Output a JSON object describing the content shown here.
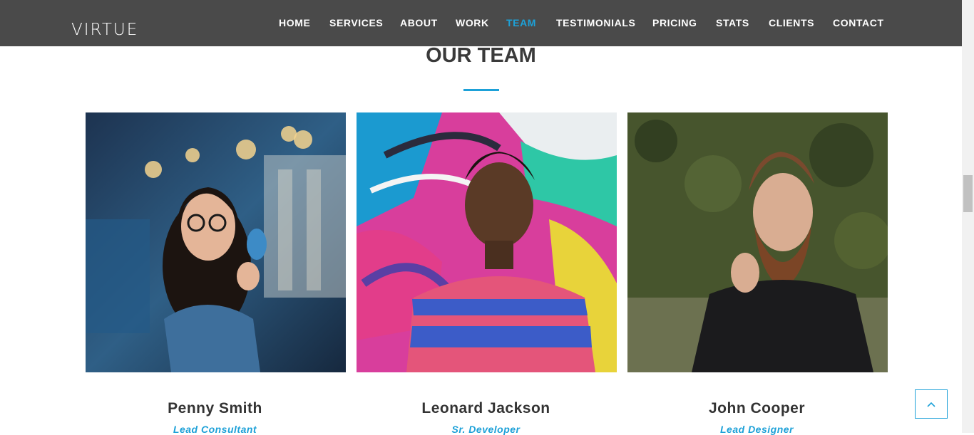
{
  "header": {
    "logo": "VIRTUE",
    "nav": [
      {
        "label": "HOME",
        "active": false
      },
      {
        "label": "SERVICES",
        "active": false
      },
      {
        "label": "ABOUT",
        "active": false
      },
      {
        "label": "WORK",
        "active": false
      },
      {
        "label": "TEAM",
        "active": true
      },
      {
        "label": "TESTIMONIALS",
        "active": false
      },
      {
        "label": "PRICING",
        "active": false
      },
      {
        "label": "STATS",
        "active": false
      },
      {
        "label": "CLIENTS",
        "active": false
      },
      {
        "label": "CONTACT",
        "active": false
      }
    ]
  },
  "team": {
    "title": "OUR TEAM",
    "members": [
      {
        "name": "Penny Smith",
        "role": "Lead Consultant"
      },
      {
        "name": "Leonard Jackson",
        "role": "Sr. Developer"
      },
      {
        "name": "John Cooper",
        "role": "Lead Designer"
      }
    ]
  },
  "colors": {
    "accent": "#1da1d8",
    "navbar": "#4a4a4a",
    "heading": "#3a3a3a"
  },
  "icons": {
    "back_to_top": "chevron-up-icon"
  }
}
